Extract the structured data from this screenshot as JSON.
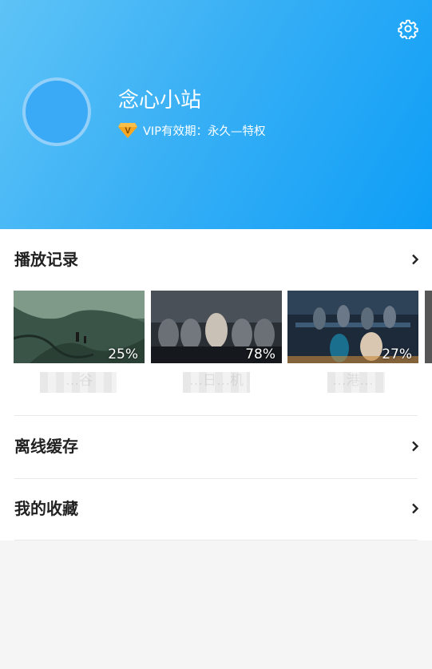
{
  "header": {
    "settings_icon": "gear-icon",
    "username": "念心小站",
    "vip_badge_letter": "V",
    "vip_text": "VIP有效期：永久—特权",
    "colors": {
      "gradient_start": "#5ec3f6",
      "gradient_end": "#0e9ef7",
      "vip_badge": "#f5a623"
    }
  },
  "play_history": {
    "title": "播放记录",
    "items": [
      {
        "title": "…谷",
        "progress": "25%"
      },
      {
        "title": "…日…机",
        "progress": "78%"
      },
      {
        "title": "…港…",
        "progress": "27%"
      }
    ]
  },
  "offline_cache": {
    "title": "离线缓存"
  },
  "favorites": {
    "title": "我的收藏"
  }
}
